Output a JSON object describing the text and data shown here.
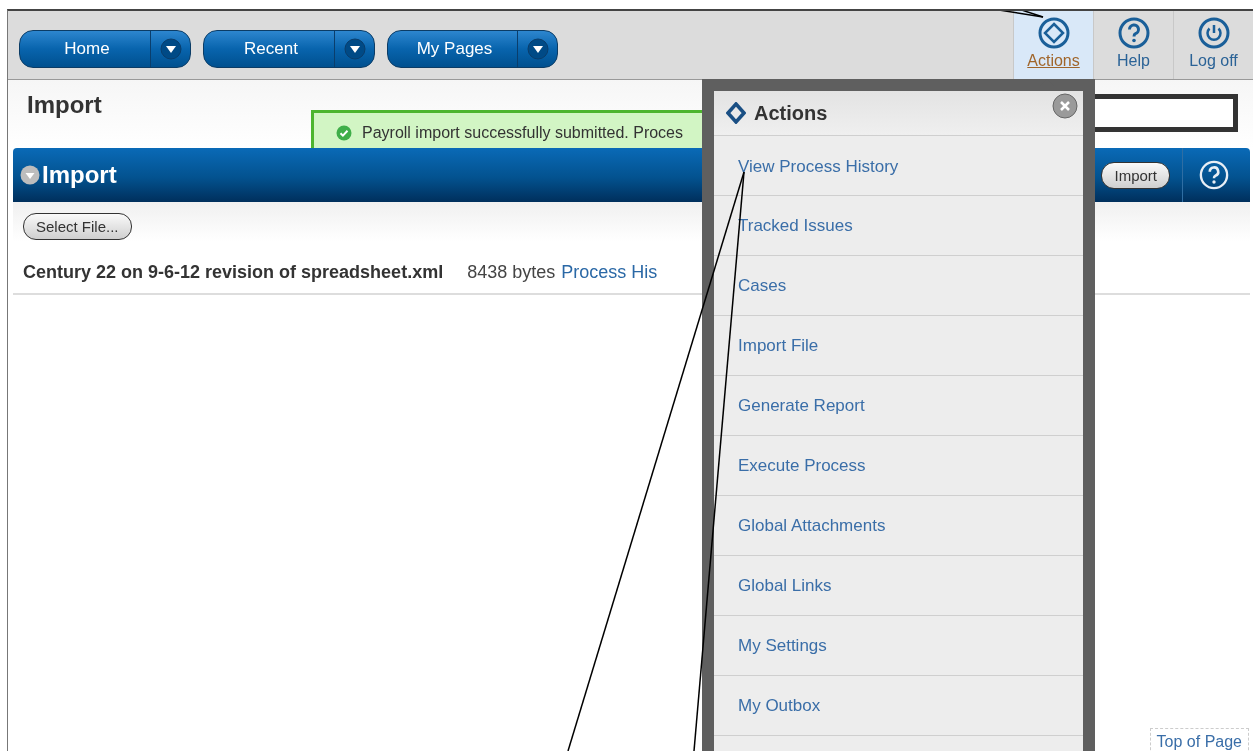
{
  "nav_buttons": [
    {
      "label": "Home"
    },
    {
      "label": "Recent"
    },
    {
      "label": "My Pages"
    }
  ],
  "toolbar": [
    {
      "label": "Actions",
      "kind": "actions",
      "selected": true
    },
    {
      "label": "Help",
      "kind": "help",
      "selected": false
    },
    {
      "label": "Log off",
      "kind": "power",
      "selected": false
    }
  ],
  "page_title": "Import",
  "message": "Payroll import successfully submitted. Proces",
  "panel": {
    "title": "Import",
    "button": "Import",
    "select_button": "Select File...",
    "file": {
      "name": "Century 22 on 9-6-12 revision of spreadsheet.xml",
      "size": "8438 bytes",
      "link": "Process His"
    }
  },
  "actions_menu": {
    "title": "Actions",
    "items": [
      "View Process History",
      "Tracked Issues",
      "Cases",
      "Import File",
      "Generate Report",
      "Execute Process",
      "Global Attachments",
      "Global Links",
      "My Settings",
      "My Outbox"
    ]
  },
  "footer_link": "Top of Page"
}
